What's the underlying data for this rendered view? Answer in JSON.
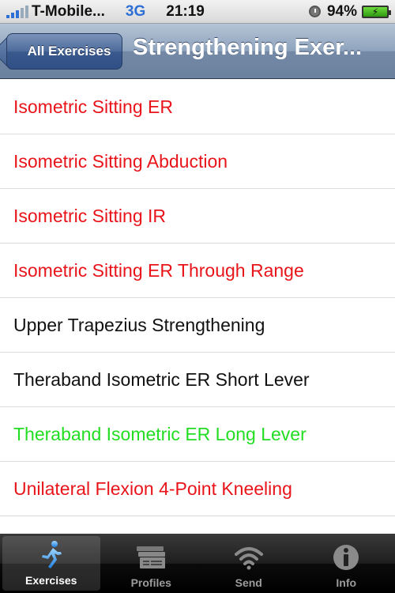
{
  "status_bar": {
    "carrier": "T-Mobile...",
    "network": "3G",
    "time": "21:19",
    "battery_percent": "94%"
  },
  "nav_bar": {
    "back_label": "All Exercises",
    "title": "Strengthening Exer..."
  },
  "exercises": [
    {
      "label": "Isometric Sitting ER",
      "color": "#e8141a"
    },
    {
      "label": "Isometric Sitting Abduction",
      "color": "#e8141a"
    },
    {
      "label": "Isometric Sitting IR",
      "color": "#e8141a"
    },
    {
      "label": "Isometric Sitting ER Through Range",
      "color": "#e8141a"
    },
    {
      "label": "Upper Trapezius Strengthening",
      "color": "#111111"
    },
    {
      "label": "Theraband Isometric ER Short Lever",
      "color": "#111111"
    },
    {
      "label": "Theraband Isometric ER Long Lever",
      "color": "#22dd22"
    },
    {
      "label": "Unilateral Flexion 4-Point Kneeling",
      "color": "#e8141a"
    }
  ],
  "tab_bar": {
    "tabs": [
      {
        "label": "Exercises",
        "icon": "runner-icon",
        "active": true
      },
      {
        "label": "Profiles",
        "icon": "profiles-icon",
        "active": false
      },
      {
        "label": "Send",
        "icon": "wifi-icon",
        "active": false
      },
      {
        "label": "Info",
        "icon": "info-icon",
        "active": false
      }
    ]
  }
}
